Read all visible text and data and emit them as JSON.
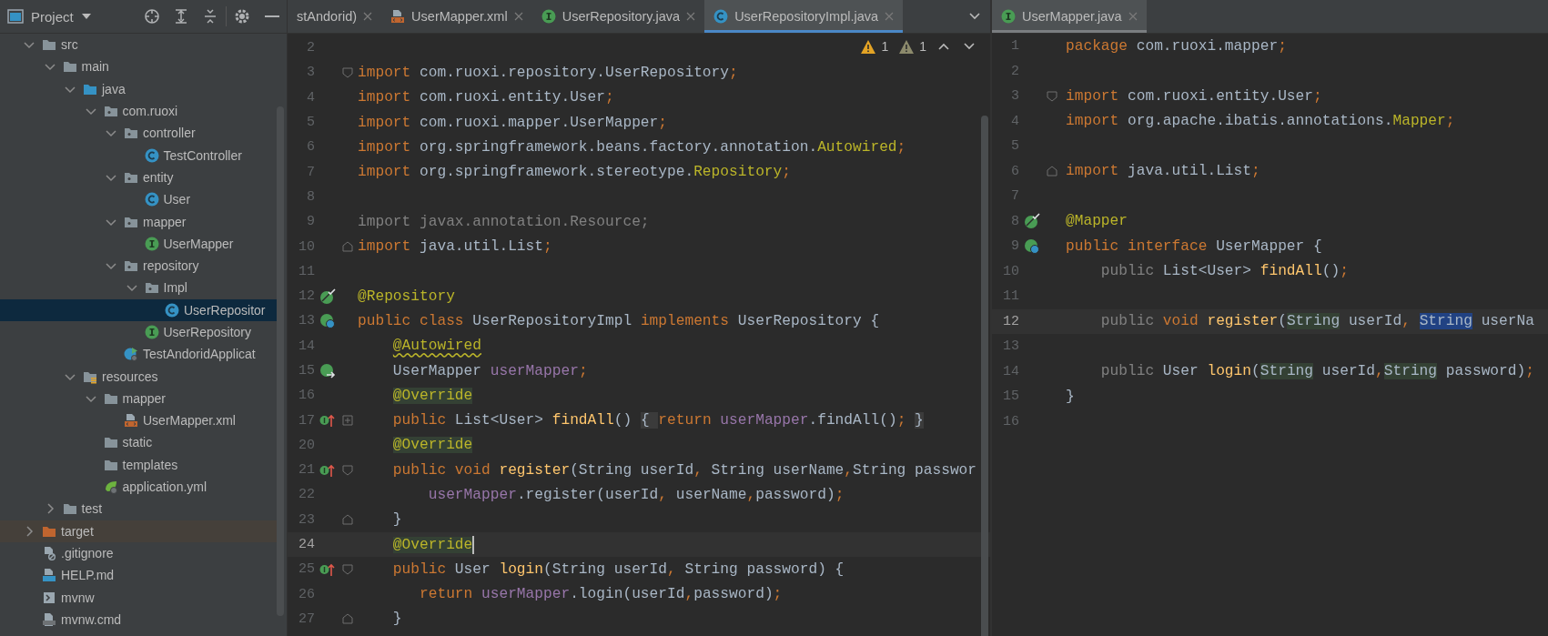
{
  "project_panel": {
    "title": "Project",
    "tree": [
      {
        "label": "src",
        "kind": "folder",
        "expanded": true,
        "selected": false,
        "children": [
          {
            "label": "main",
            "kind": "folder",
            "expanded": true,
            "selected": false,
            "children": [
              {
                "label": "java",
                "kind": "source-folder",
                "expanded": true,
                "selected": false,
                "children": [
                  {
                    "label": "com.ruoxi",
                    "kind": "package",
                    "expanded": true,
                    "selected": false,
                    "children": [
                      {
                        "label": "controller",
                        "kind": "package",
                        "expanded": true,
                        "selected": false,
                        "children": [
                          {
                            "label": "TestController",
                            "kind": "class",
                            "selected": false
                          }
                        ]
                      },
                      {
                        "label": "entity",
                        "kind": "package",
                        "expanded": true,
                        "selected": false,
                        "children": [
                          {
                            "label": "User",
                            "kind": "class",
                            "selected": false
                          }
                        ]
                      },
                      {
                        "label": "mapper",
                        "kind": "package",
                        "expanded": true,
                        "selected": false,
                        "children": [
                          {
                            "label": "UserMapper",
                            "kind": "interface",
                            "selected": false
                          }
                        ]
                      },
                      {
                        "label": "repository",
                        "kind": "package",
                        "expanded": true,
                        "selected": false,
                        "children": [
                          {
                            "label": "Impl",
                            "kind": "package",
                            "expanded": true,
                            "selected": false,
                            "children": [
                              {
                                "label": "UserRepositor",
                                "kind": "class",
                                "selected": true
                              }
                            ]
                          },
                          {
                            "label": "UserRepository",
                            "kind": "interface",
                            "selected": false
                          }
                        ]
                      },
                      {
                        "label": "TestAndoridApplicat",
                        "kind": "app-class",
                        "selected": false
                      }
                    ]
                  }
                ]
              },
              {
                "label": "resources",
                "kind": "resources-folder",
                "expanded": true,
                "selected": false,
                "children": [
                  {
                    "label": "mapper",
                    "kind": "folder",
                    "expanded": true,
                    "selected": false,
                    "children": [
                      {
                        "label": "UserMapper.xml",
                        "kind": "xml",
                        "selected": false
                      }
                    ]
                  },
                  {
                    "label": "static",
                    "kind": "folder",
                    "selected": false
                  },
                  {
                    "label": "templates",
                    "kind": "folder",
                    "selected": false
                  },
                  {
                    "label": "application.yml",
                    "kind": "spring-yml",
                    "selected": false
                  }
                ]
              }
            ]
          },
          {
            "label": "test",
            "kind": "folder",
            "expanded": false,
            "selected": false
          }
        ]
      },
      {
        "label": "target",
        "kind": "excluded-folder",
        "expanded": false,
        "selected": false
      },
      {
        "label": ".gitignore",
        "kind": "ignore-file",
        "selected": false
      },
      {
        "label": "HELP.md",
        "kind": "markdown",
        "selected": false
      },
      {
        "label": "mvnw",
        "kind": "script",
        "selected": false
      },
      {
        "label": "mvnw.cmd",
        "kind": "cmd-file",
        "selected": false
      }
    ]
  },
  "left_editor": {
    "tabs": [
      {
        "label": "stAndorid)",
        "selected": false
      },
      {
        "label": "UserMapper.xml",
        "kind": "xml",
        "selected": false
      },
      {
        "label": "UserRepository.java",
        "kind": "interface",
        "selected": false
      },
      {
        "label": "UserRepositoryImpl.java",
        "kind": "class",
        "selected": true
      }
    ],
    "inspections": [
      {
        "kind": "warning",
        "count": "1"
      },
      {
        "kind": "weak-warning",
        "count": "1"
      }
    ],
    "lines": [
      {
        "number": "2",
        "current": false
      },
      {
        "number": "3",
        "current": false,
        "markers": [
          {
            "kind": "fold-start"
          }
        ],
        "tokens": [
          {
            "kind": "kw",
            "text": "import"
          },
          {
            "kind": "plain",
            "text": " com.ruoxi.repository.UserRepository"
          },
          {
            "kind": "kw",
            "text": ";"
          }
        ]
      },
      {
        "number": "4",
        "current": false,
        "tokens": [
          {
            "kind": "kw",
            "text": "import"
          },
          {
            "kind": "plain",
            "text": " com.ruoxi.entity.User"
          },
          {
            "kind": "kw",
            "text": ";"
          }
        ]
      },
      {
        "number": "5",
        "current": false,
        "tokens": [
          {
            "kind": "kw",
            "text": "import"
          },
          {
            "kind": "plain",
            "text": " com.ruoxi.mapper.UserMapper"
          },
          {
            "kind": "kw",
            "text": ";"
          }
        ]
      },
      {
        "number": "6",
        "current": false,
        "tokens": [
          {
            "kind": "kw",
            "text": "import"
          },
          {
            "kind": "plain",
            "text": " org.springframework.beans.factory.annotation."
          },
          {
            "kind": "ann",
            "text": "Autowired"
          },
          {
            "kind": "kw",
            "text": ";"
          }
        ]
      },
      {
        "number": "7",
        "current": false,
        "tokens": [
          {
            "kind": "kw",
            "text": "import"
          },
          {
            "kind": "plain",
            "text": " org.springframework.stereotype."
          },
          {
            "kind": "ann",
            "text": "Repository"
          },
          {
            "kind": "kw",
            "text": ";"
          }
        ]
      },
      {
        "number": "8",
        "current": false
      },
      {
        "number": "9",
        "current": false,
        "tokens": [
          {
            "kind": "dim",
            "text": "import javax.annotation.Resource;"
          }
        ]
      },
      {
        "number": "10",
        "current": false,
        "markers": [
          {
            "kind": "fold-end"
          }
        ],
        "tokens": [
          {
            "kind": "kw",
            "text": "import"
          },
          {
            "kind": "plain",
            "text": " java.util.List"
          },
          {
            "kind": "kw",
            "text": ";"
          }
        ]
      },
      {
        "number": "11",
        "current": false
      },
      {
        "number": "12",
        "current": false,
        "markers": [
          {
            "kind": "bean-check"
          }
        ],
        "tokens": [
          {
            "kind": "ann",
            "text": "@Repository"
          }
        ]
      },
      {
        "number": "13",
        "current": false,
        "markers": [
          {
            "kind": "bean-class"
          }
        ],
        "tokens": [
          {
            "kind": "kw",
            "text": "public class "
          },
          {
            "kind": "plain",
            "text": "UserRepositoryImpl "
          },
          {
            "kind": "kw",
            "text": "implements "
          },
          {
            "kind": "plain",
            "text": "UserRepository {"
          }
        ]
      },
      {
        "number": "14",
        "current": false,
        "tokens": [
          {
            "kind": "ann-warn",
            "text": "    @Autowired"
          }
        ]
      },
      {
        "number": "15",
        "current": false,
        "markers": [
          {
            "kind": "bean-arrow"
          }
        ],
        "tokens": [
          {
            "kind": "plain",
            "text": "    UserMapper "
          },
          {
            "kind": "field",
            "text": "userMapper"
          },
          {
            "kind": "kw",
            "text": ";"
          }
        ]
      },
      {
        "number": "16",
        "current": false,
        "tokens": [
          {
            "kind": "ann-mark",
            "text": "    @Override"
          }
        ]
      },
      {
        "number": "17",
        "current": false,
        "markers": [
          {
            "kind": "implements"
          },
          {
            "kind": "fold-collapsed"
          }
        ],
        "tokens": [
          {
            "kind": "kw",
            "text": "    public "
          },
          {
            "kind": "plain",
            "text": "List<User> "
          },
          {
            "kind": "method",
            "text": "findAll"
          },
          {
            "kind": "plain",
            "text": "()"
          },
          {
            "kind": "fold",
            "text": " { "
          },
          {
            "kind": "kw",
            "text": "return "
          },
          {
            "kind": "field",
            "text": "userMapper"
          },
          {
            "kind": "plain",
            "text": ".findAll()"
          },
          {
            "kind": "kw",
            "text": ";"
          },
          {
            "kind": "fold",
            "text": " }"
          }
        ]
      },
      {
        "number": "20",
        "current": false,
        "tokens": [
          {
            "kind": "ann-mark",
            "text": "    @Override"
          }
        ]
      },
      {
        "number": "21",
        "current": false,
        "markers": [
          {
            "kind": "implements"
          },
          {
            "kind": "fold-start"
          }
        ],
        "tokens": [
          {
            "kind": "kw",
            "text": "    public void "
          },
          {
            "kind": "method",
            "text": "register"
          },
          {
            "kind": "plain",
            "text": "(String userId"
          },
          {
            "kind": "kw",
            "text": ", "
          },
          {
            "kind": "plain",
            "text": "String userName"
          },
          {
            "kind": "kw",
            "text": ","
          },
          {
            "kind": "plain",
            "text": "String passwor"
          }
        ]
      },
      {
        "number": "22",
        "current": false,
        "tokens": [
          {
            "kind": "field",
            "text": "        userMapper"
          },
          {
            "kind": "plain",
            "text": ".register(userId"
          },
          {
            "kind": "kw",
            "text": ", "
          },
          {
            "kind": "plain",
            "text": "userName"
          },
          {
            "kind": "kw",
            "text": ","
          },
          {
            "kind": "plain",
            "text": "password)"
          },
          {
            "kind": "kw",
            "text": ";"
          }
        ]
      },
      {
        "number": "23",
        "current": false,
        "markers": [
          {
            "kind": "fold-end"
          }
        ],
        "tokens": [
          {
            "kind": "plain",
            "text": "    }"
          }
        ]
      },
      {
        "number": "24",
        "current": true,
        "caret": true,
        "tokens": [
          {
            "kind": "ann-mark",
            "text": "    @Override"
          }
        ]
      },
      {
        "number": "25",
        "current": false,
        "markers": [
          {
            "kind": "implements"
          },
          {
            "kind": "fold-start"
          }
        ],
        "tokens": [
          {
            "kind": "kw",
            "text": "    public "
          },
          {
            "kind": "plain",
            "text": "User "
          },
          {
            "kind": "method",
            "text": "login"
          },
          {
            "kind": "plain",
            "text": "(String userId"
          },
          {
            "kind": "kw",
            "text": ", "
          },
          {
            "kind": "plain",
            "text": "String password) {"
          }
        ]
      },
      {
        "number": "26",
        "current": false,
        "tokens": [
          {
            "kind": "kw",
            "text": "       return "
          },
          {
            "kind": "field",
            "text": "userMapper"
          },
          {
            "kind": "plain",
            "text": ".login(userId"
          },
          {
            "kind": "kw",
            "text": ","
          },
          {
            "kind": "plain",
            "text": "password)"
          },
          {
            "kind": "kw",
            "text": ";"
          }
        ]
      },
      {
        "number": "27",
        "current": false,
        "markers": [
          {
            "kind": "fold-end"
          }
        ],
        "tokens": [
          {
            "kind": "plain",
            "text": "    }"
          }
        ]
      }
    ]
  },
  "right_editor": {
    "tabs": [
      {
        "label": "UserMapper.java",
        "kind": "interface",
        "selected": true
      }
    ],
    "lines": [
      {
        "number": "1",
        "current": false,
        "tokens": [
          {
            "kind": "kw",
            "text": "package"
          },
          {
            "kind": "plain",
            "text": " com.ruoxi.mapper"
          },
          {
            "kind": "kw",
            "text": ";"
          }
        ]
      },
      {
        "number": "2",
        "current": false
      },
      {
        "number": "3",
        "current": false,
        "markers": [
          {
            "kind": "fold-start"
          }
        ],
        "tokens": [
          {
            "kind": "kw",
            "text": "import"
          },
          {
            "kind": "plain",
            "text": " com.ruoxi.entity.User"
          },
          {
            "kind": "kw",
            "text": ";"
          }
        ]
      },
      {
        "number": "4",
        "current": false,
        "tokens": [
          {
            "kind": "kw",
            "text": "import"
          },
          {
            "kind": "plain",
            "text": " org.apache.ibatis.annotations."
          },
          {
            "kind": "ann",
            "text": "Mapper"
          },
          {
            "kind": "kw",
            "text": ";"
          }
        ]
      },
      {
        "number": "5",
        "current": false
      },
      {
        "number": "6",
        "current": false,
        "markers": [
          {
            "kind": "fold-end"
          }
        ],
        "tokens": [
          {
            "kind": "kw",
            "text": "import"
          },
          {
            "kind": "plain",
            "text": " java.util.List"
          },
          {
            "kind": "kw",
            "text": ";"
          }
        ]
      },
      {
        "number": "7",
        "current": false
      },
      {
        "number": "8",
        "current": false,
        "markers": [
          {
            "kind": "bean-check"
          }
        ],
        "tokens": [
          {
            "kind": "ann",
            "text": "@Mapper"
          }
        ]
      },
      {
        "number": "9",
        "current": false,
        "markers": [
          {
            "kind": "bean-class"
          }
        ],
        "tokens": [
          {
            "kind": "kw",
            "text": "public interface "
          },
          {
            "kind": "plain",
            "text": "UserMapper {"
          }
        ]
      },
      {
        "number": "10",
        "current": false,
        "tokens": [
          {
            "kind": "dim",
            "text": "    public "
          },
          {
            "kind": "plain",
            "text": "List<User> "
          },
          {
            "kind": "method",
            "text": "findAll"
          },
          {
            "kind": "plain",
            "text": "()"
          },
          {
            "kind": "kw",
            "text": ";"
          }
        ]
      },
      {
        "number": "11",
        "current": false
      },
      {
        "number": "12",
        "current": true,
        "tokens": [
          {
            "kind": "dim",
            "text": "    public "
          },
          {
            "kind": "kw",
            "text": "void "
          },
          {
            "kind": "method",
            "text": "register"
          },
          {
            "kind": "plain",
            "text": "("
          },
          {
            "kind": "param",
            "text": "String"
          },
          {
            "kind": "plain",
            "text": " userId"
          },
          {
            "kind": "kw",
            "text": ", "
          },
          {
            "kind": "sel",
            "text": "String"
          },
          {
            "kind": "plain",
            "text": " userNa"
          }
        ]
      },
      {
        "number": "13",
        "current": false
      },
      {
        "number": "14",
        "current": false,
        "tokens": [
          {
            "kind": "dim",
            "text": "    public "
          },
          {
            "kind": "plain",
            "text": "User "
          },
          {
            "kind": "method",
            "text": "login"
          },
          {
            "kind": "plain",
            "text": "("
          },
          {
            "kind": "param",
            "text": "String"
          },
          {
            "kind": "plain",
            "text": " userId"
          },
          {
            "kind": "kw",
            "text": ","
          },
          {
            "kind": "param",
            "text": "String"
          },
          {
            "kind": "plain",
            "text": " password)"
          },
          {
            "kind": "kw",
            "text": ";"
          }
        ]
      },
      {
        "number": "15",
        "current": false,
        "tokens": [
          {
            "kind": "plain",
            "text": "}"
          }
        ]
      },
      {
        "number": "16",
        "current": false
      }
    ]
  }
}
